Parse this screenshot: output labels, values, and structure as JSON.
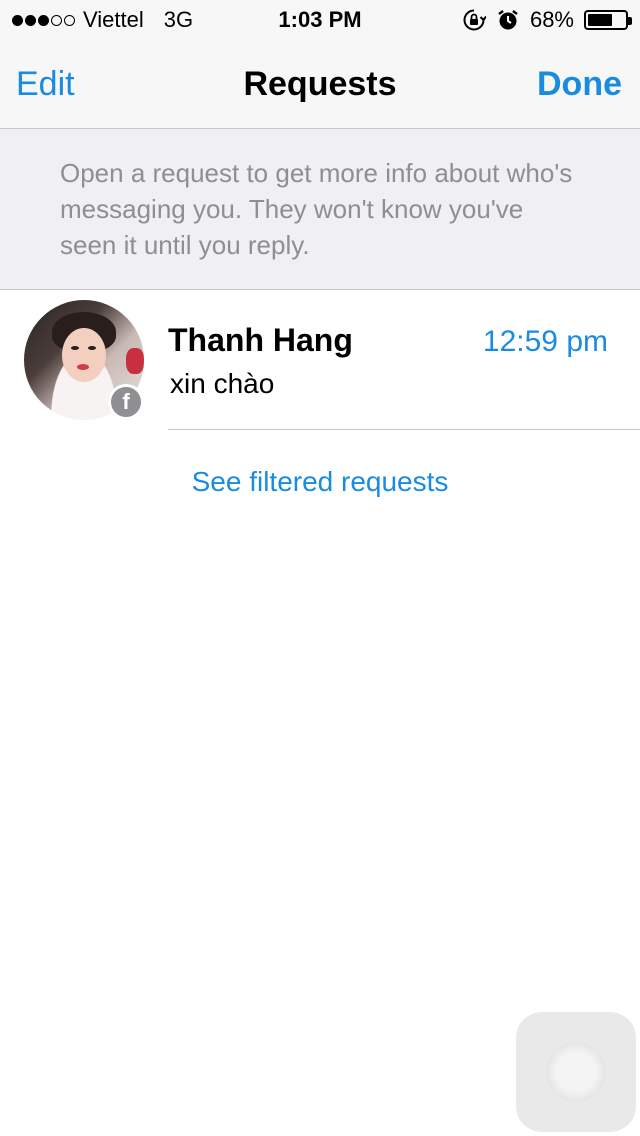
{
  "status_bar": {
    "signal_dots_filled": 3,
    "signal_dots_total": 5,
    "carrier": "Viettel",
    "network": "3G",
    "time": "1:03 PM",
    "battery_percent_label": "68%",
    "battery_level": 0.68,
    "icons": [
      "rotation-lock-icon",
      "alarm-icon"
    ]
  },
  "nav": {
    "left_label": "Edit",
    "title": "Requests",
    "right_label": "Done"
  },
  "info": {
    "text": "Open a request to get more info about who's messaging you. They won't know you've seen it until you reply."
  },
  "requests": [
    {
      "name": "Thanh Hang",
      "time": "12:59 pm",
      "message": "xin chào",
      "badge_icon": "facebook-icon"
    }
  ],
  "filtered_link": "See filtered requests",
  "colors": {
    "accent": "#1a8ce0",
    "bar_background": "#f7f7f7",
    "info_background": "#efeff4",
    "secondary_text": "#8e8e93"
  }
}
